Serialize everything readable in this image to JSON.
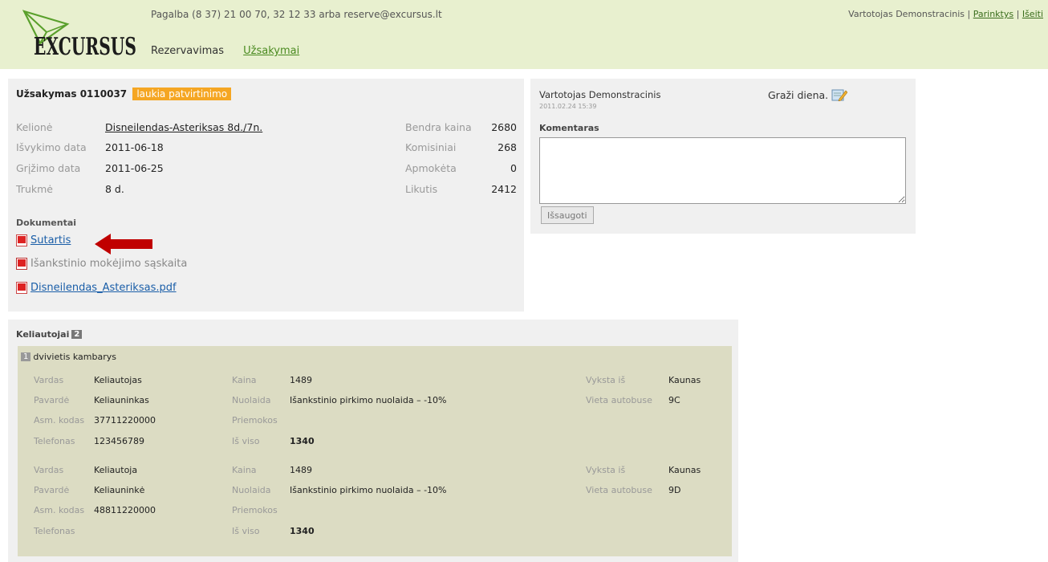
{
  "header": {
    "logo_text": "EXCURSUS",
    "help_text": "Pagalba (8 37) 21 00 70, 32 12 33 arba reserve@excursus.lt",
    "user_name": "Vartotojas Demonstracinis",
    "settings_label": "Parinktys",
    "logout_label": "Išeiti",
    "separator": "|",
    "nav": {
      "reservations_label": "Rezervavimas",
      "orders_label": "Užsakymai"
    }
  },
  "order": {
    "title": "Užsakymas 0110037",
    "status": "laukia patvirtinimo",
    "fields": [
      {
        "label": "Kelionė",
        "value": "Disneilendas-Asteriksas 8d./7n."
      },
      {
        "label": "Išvykimo data",
        "value": "2011-06-18"
      },
      {
        "label": "Grįžimo data",
        "value": "2011-06-25"
      },
      {
        "label": "Trukmė",
        "value": "8 d."
      }
    ],
    "totals": [
      {
        "label": "Bendra kaina",
        "value": "2680"
      },
      {
        "label": "Komisiniai",
        "value": "268"
      },
      {
        "label": "Apmokėta",
        "value": "0"
      },
      {
        "label": "Likutis",
        "value": "2412"
      }
    ],
    "documents_title": "Dokumentai",
    "documents": [
      {
        "label": "Sutartis"
      },
      {
        "label": "Išankstinio mokėjimo sąskaita"
      },
      {
        "label": "Disneilendas_Asteriksas.pdf"
      }
    ]
  },
  "comment": {
    "user": "Vartotojas Demonstracinis",
    "date": "2011.02.24 15:39",
    "greeting": "Graži diena.",
    "label": "Komentaras",
    "value": "",
    "save_label": "Išsaugoti"
  },
  "travelers": {
    "title": "Keliautojai",
    "count": "2",
    "room": {
      "number": "1",
      "type": "dvivietis kambarys"
    },
    "labels": {
      "first_name": "Vardas",
      "last_name": "Pavardė",
      "personal_code": "Asm. kodas",
      "phone": "Telefonas",
      "price": "Kaina",
      "discount": "Nuolaida",
      "extras": "Priemokos",
      "total": "Iš viso",
      "departs_from": "Vyksta iš",
      "bus_seat": "Vieta autobuse"
    },
    "list": [
      {
        "first_name": "Keliautojas",
        "last_name": "Keliauninkas",
        "personal_code": "37711220000",
        "phone": "123456789",
        "price": "1489",
        "discount": "Išankstinio pirkimo nuolaida – -10%",
        "extras": "",
        "total": "1340",
        "departs_from": "Kaunas",
        "bus_seat": "9C"
      },
      {
        "first_name": "Keliautoja",
        "last_name": "Keliauninkė",
        "personal_code": "48811220000",
        "phone": "",
        "price": "1489",
        "discount": "Išankstinio pirkimo nuolaida – -10%",
        "extras": "",
        "total": "1340",
        "departs_from": "Kaunas",
        "bus_seat": "9D"
      }
    ]
  },
  "colors": {
    "header_bg": "#e8f0cf",
    "status_badge": "#f5a623",
    "room_bg": "#dcdcc3",
    "arrow": "#c00000",
    "link": "#1a5ea8"
  }
}
